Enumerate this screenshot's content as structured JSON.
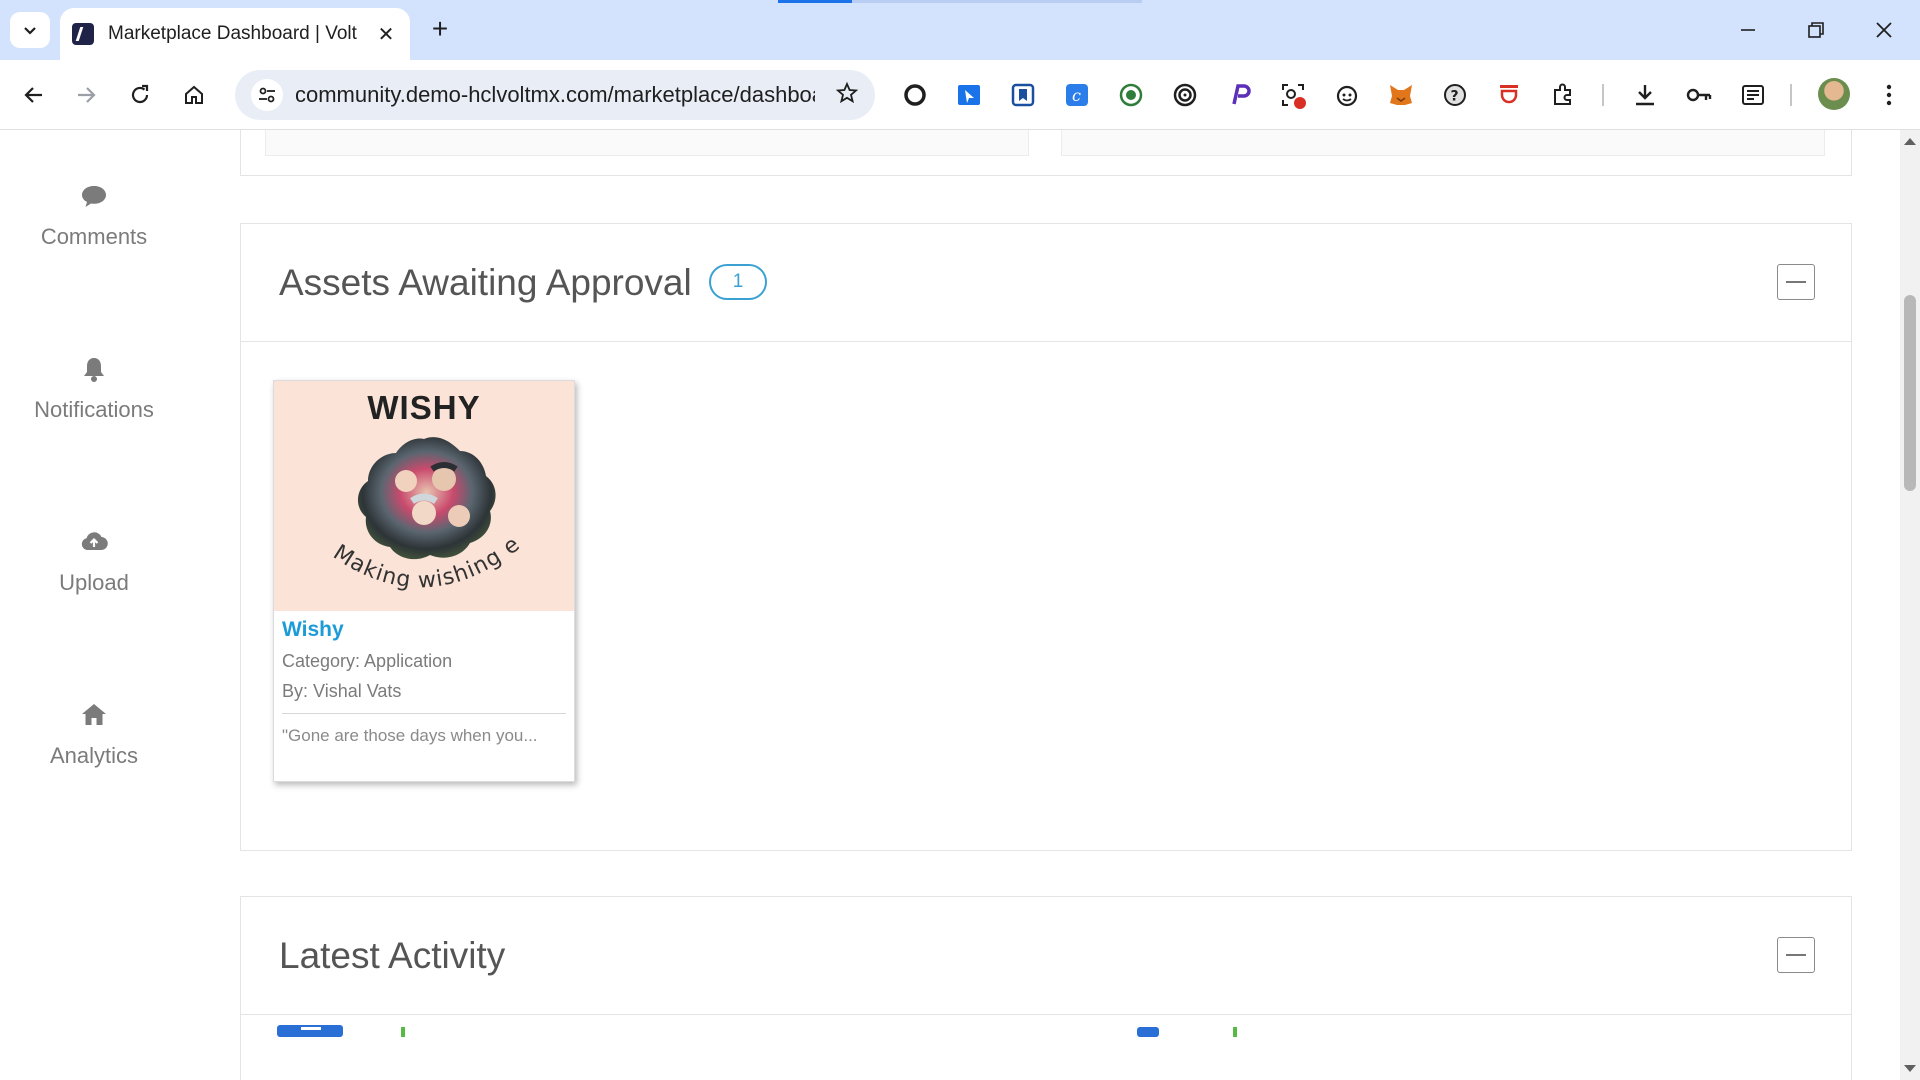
{
  "browser": {
    "tab_title": "Marketplace Dashboard | Voltmx",
    "tab_close": "✕",
    "new_tab": "+",
    "url": "community.demo-hclvoltmx.com/marketplace/dashboard",
    "window_controls": {
      "minimize": "—",
      "restore": "❐",
      "close": "✕"
    }
  },
  "sidebar": {
    "items": [
      {
        "label": "Comments",
        "icon": "comment-icon"
      },
      {
        "label": "Notifications",
        "icon": "bell-icon"
      },
      {
        "label": "Upload",
        "icon": "cloud-upload-icon"
      },
      {
        "label": "Analytics",
        "icon": "home-icon"
      }
    ]
  },
  "assets_panel": {
    "title": "Assets Awaiting Approval",
    "count": "1",
    "asset": {
      "logo_text": "WISHY",
      "tagline": "Making wishing easy",
      "name": "Wishy",
      "category": "Category: Application",
      "author": "By: Vishal Vats",
      "description": "\"Gone are those days when you..."
    }
  },
  "activity_panel": {
    "title": "Latest Activity"
  },
  "colors": {
    "accent_blue": "#1b9bd7",
    "badge_blue": "#3aa1d3",
    "tabstrip": "#d3e3fd",
    "card_image_bg": "#fbe3d7"
  }
}
